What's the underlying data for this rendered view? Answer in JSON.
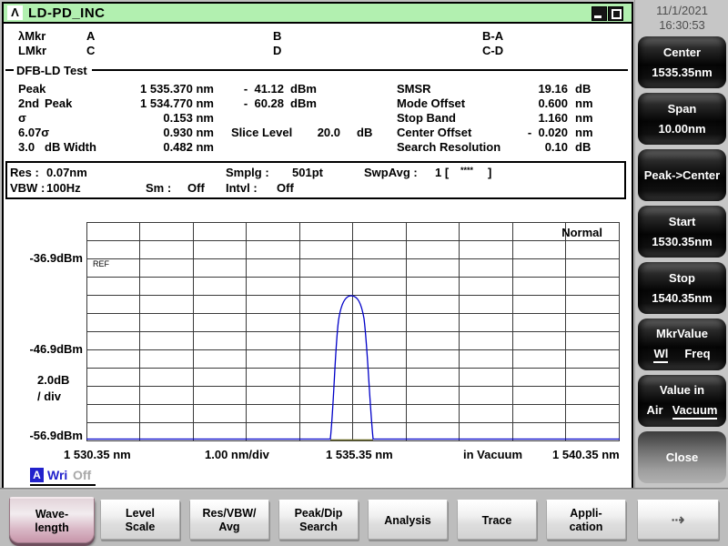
{
  "colors": {
    "titlebar_green": "#b2f0b0",
    "trace_blue": "#0000c8",
    "accent_blue": "#2222cc",
    "fn_active_pink": "#c795aa"
  },
  "window": {
    "logo": "Λ",
    "title": "LD-PD_INC"
  },
  "statusbar": {
    "date": "11/1/2021",
    "time": "16:30:53"
  },
  "markers": {
    "l1_name": "λMkr",
    "l1_a": "A",
    "l1_b": "B",
    "l1_diff": "B-A",
    "l2_name": "LMkr",
    "l2_c": "C",
    "l2_d": "D",
    "l2_diff": "C-D"
  },
  "analysis": {
    "section_title": "DFB-LD Test",
    "left": [
      {
        "l1": "Peak",
        "l2": "",
        "wl": "1 535.370 nm",
        "lvl": "-  41.12",
        "lvl_unit": "dBm"
      },
      {
        "l1": "2nd",
        "l2": "Peak",
        "wl": "1 534.770 nm",
        "lvl": "-  60.28",
        "lvl_unit": "dBm"
      },
      {
        "l1": "σ",
        "l2": "",
        "wl": "0.153 nm"
      },
      {
        "l1": "6.07σ",
        "l2": "",
        "wl": "0.930 nm"
      },
      {
        "l1": "3.0",
        "l2": "dB Width",
        "wl": "0.482 nm"
      }
    ],
    "slice_label": "Slice Level",
    "slice_value": "20.0",
    "slice_unit": "dB",
    "right": [
      {
        "label": "SMSR",
        "value": "19.16",
        "unit": "dB"
      },
      {
        "label": "Mode Offset",
        "value": "0.600",
        "unit": "nm"
      },
      {
        "label": "Stop Band",
        "value": "1.160",
        "unit": "nm"
      },
      {
        "label": "Center Offset",
        "value": "-  0.020",
        "unit": "nm"
      },
      {
        "label": "Search Resolution",
        "value": "0.10",
        "unit": "dB"
      }
    ]
  },
  "sweep": {
    "res_label": "Res :",
    "res_value": "0.07nm",
    "vbw_label": "VBW :",
    "vbw_value": "100Hz",
    "sm_label": "Sm :",
    "sm_value": "Off",
    "smplg_label": "Smplg :",
    "smplg_value": "501pt",
    "intvl_label": "Intvl :",
    "intvl_value": "Off",
    "swpavg_label": "SwpAvg :",
    "swpavg_value": "1 [",
    "swpavg_stars": "****",
    "swpavg_close": "]"
  },
  "graph": {
    "mode": "Normal",
    "ref": "REF",
    "y1": "-36.9dBm",
    "y2": "-46.9dBm",
    "y3": "-56.9dBm",
    "ydiv1": "2.0dB",
    "ydiv2": "/ div",
    "x1": "1 530.35 nm",
    "xdiv": "1.00 nm/div",
    "x2": "1 535.35 nm",
    "xmed": "in Vacuum",
    "x3": "1 540.35 nm",
    "trace_label": "A",
    "trace_mode": "Wri",
    "trace_state": "Off"
  },
  "chart_data": {
    "type": "line",
    "title": "",
    "x_axis": {
      "start_nm": 1530.35,
      "center_nm": 1535.35,
      "stop_nm": 1540.35,
      "div_nm": 1.0,
      "medium": "in Vacuum"
    },
    "y_axis": {
      "labels_dbm": [
        -36.9,
        -46.9,
        -56.9
      ],
      "div_db": 2.0
    },
    "series": [
      {
        "name": "Trace A (Wri)",
        "peak_nm": 1535.37,
        "peak_dbm": -41.12,
        "baseline_dbm": -56.9,
        "points_nm_dbm": [
          [
            1530.35,
            -56.9
          ],
          [
            1534.55,
            -56.9
          ],
          [
            1534.8,
            -50.0
          ],
          [
            1535.0,
            -44.0
          ],
          [
            1535.2,
            -41.6
          ],
          [
            1535.37,
            -41.12
          ],
          [
            1535.55,
            -41.7
          ],
          [
            1535.75,
            -44.5
          ],
          [
            1535.95,
            -51.0
          ],
          [
            1536.15,
            -56.9
          ],
          [
            1540.35,
            -56.9
          ]
        ]
      }
    ],
    "annotations": [
      "REF",
      "Normal"
    ],
    "legend": "off",
    "grid": "on"
  },
  "softkeys": [
    {
      "line1": "Center",
      "line2": "1535.35nm"
    },
    {
      "line1": "Span",
      "line2": "10.00nm"
    },
    {
      "line1": "Peak->Center"
    },
    {
      "line1": "Start",
      "line2": "1530.35nm"
    },
    {
      "line1": "Stop",
      "line2": "1540.35nm"
    },
    {
      "line1": "MkrValue",
      "opt_a": "Wl",
      "opt_b": "Freq",
      "selected": "Wl"
    },
    {
      "line1": "Value in",
      "opt_a": "Air",
      "opt_b": "Vacuum",
      "selected": "Vacuum"
    },
    {
      "line1": "Close"
    }
  ],
  "fnkeys": [
    {
      "line1": "Wave-",
      "line2": "length",
      "active": true
    },
    {
      "line1": "Level",
      "line2": "Scale"
    },
    {
      "line1": "Res/VBW/",
      "line2": "Avg"
    },
    {
      "line1": "Peak/Dip",
      "line2": "Search"
    },
    {
      "line1": "Analysis"
    },
    {
      "line1": "Trace"
    },
    {
      "line1": "Appli-",
      "line2": "cation"
    },
    {
      "line1": "⇢"
    }
  ]
}
